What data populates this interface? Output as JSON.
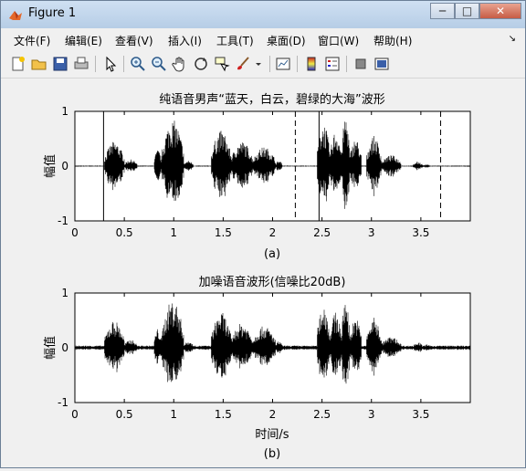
{
  "window": {
    "title": "Figure 1"
  },
  "menus": [
    "文件(F)",
    "编辑(E)",
    "查看(V)",
    "插入(I)",
    "工具(T)",
    "桌面(D)",
    "窗口(W)",
    "帮助(H)"
  ],
  "toolbar_icons": [
    "new-figure-icon",
    "open-icon",
    "save-icon",
    "print-icon",
    "pointer-icon",
    "zoom-in-icon",
    "zoom-out-icon",
    "pan-icon",
    "rotate-3d-icon",
    "data-cursor-icon",
    "brush-icon",
    "brush-menu-icon",
    "link-plot-icon",
    "colorbar-icon",
    "legend-icon",
    "hide-plot-tools-icon",
    "show-plot-tools-icon"
  ],
  "chart_data": [
    {
      "type": "line",
      "title": "纯语音男声“蓝天，白云，碧绿的大海”波形",
      "ylabel": "幅值",
      "xlabel": "",
      "caption": "(a)",
      "xlim": [
        0,
        4
      ],
      "ylim": [
        -1,
        1
      ],
      "xticks": [
        "0",
        "0.5",
        "1",
        "1.5",
        "2",
        "2.5",
        "3",
        "3.5"
      ],
      "yticks": [
        "-1",
        "0",
        "1"
      ],
      "noise_floor": 0.01,
      "segments": [
        {
          "start": 0.3,
          "end": 0.5,
          "amp": 0.45
        },
        {
          "start": 0.5,
          "end": 0.63,
          "amp": 0.12
        },
        {
          "start": 0.8,
          "end": 0.88,
          "amp": 0.3
        },
        {
          "start": 0.88,
          "end": 1.1,
          "amp": 0.85
        },
        {
          "start": 1.1,
          "end": 1.2,
          "amp": 0.1
        },
        {
          "start": 1.38,
          "end": 1.58,
          "amp": 0.65
        },
        {
          "start": 1.58,
          "end": 1.8,
          "amp": 0.45
        },
        {
          "start": 1.8,
          "end": 2.03,
          "amp": 0.35
        },
        {
          "start": 2.03,
          "end": 2.1,
          "amp": 0.1
        },
        {
          "start": 2.45,
          "end": 2.58,
          "amp": 0.8
        },
        {
          "start": 2.58,
          "end": 2.7,
          "amp": 0.65
        },
        {
          "start": 2.7,
          "end": 2.78,
          "amp": 0.95
        },
        {
          "start": 2.78,
          "end": 2.9,
          "amp": 0.5
        },
        {
          "start": 2.95,
          "end": 3.1,
          "amp": 0.55
        },
        {
          "start": 3.1,
          "end": 3.3,
          "amp": 0.2
        },
        {
          "start": 3.42,
          "end": 3.52,
          "amp": 0.08
        },
        {
          "start": 3.52,
          "end": 3.6,
          "amp": 0.03
        }
      ],
      "markers": [
        {
          "x": 0.29,
          "style": "solid"
        },
        {
          "x": 2.23,
          "style": "dashed"
        },
        {
          "x": 2.47,
          "style": "solid"
        },
        {
          "x": 3.7,
          "style": "dashed"
        }
      ]
    },
    {
      "type": "line",
      "title": "加噪语音波形(信噪比20dB)",
      "ylabel": "幅值",
      "xlabel": "时间/s",
      "caption": "(b)",
      "xlim": [
        0,
        4
      ],
      "ylim": [
        -1,
        1
      ],
      "xticks": [
        "0",
        "0.5",
        "1",
        "1.5",
        "2",
        "2.5",
        "3",
        "3.5"
      ],
      "yticks": [
        "-1",
        "0",
        "1"
      ],
      "noise_floor": 0.04,
      "segments": [
        {
          "start": 0.3,
          "end": 0.5,
          "amp": 0.5
        },
        {
          "start": 0.5,
          "end": 0.63,
          "amp": 0.15
        },
        {
          "start": 0.8,
          "end": 0.88,
          "amp": 0.35
        },
        {
          "start": 0.88,
          "end": 1.1,
          "amp": 0.88
        },
        {
          "start": 1.1,
          "end": 1.2,
          "amp": 0.12
        },
        {
          "start": 1.38,
          "end": 1.58,
          "amp": 0.65
        },
        {
          "start": 1.58,
          "end": 1.8,
          "amp": 0.45
        },
        {
          "start": 1.8,
          "end": 2.03,
          "amp": 0.4
        },
        {
          "start": 2.03,
          "end": 2.1,
          "amp": 0.12
        },
        {
          "start": 2.45,
          "end": 2.58,
          "amp": 0.8
        },
        {
          "start": 2.58,
          "end": 2.7,
          "amp": 0.65
        },
        {
          "start": 2.7,
          "end": 2.78,
          "amp": 0.95
        },
        {
          "start": 2.78,
          "end": 2.9,
          "amp": 0.55
        },
        {
          "start": 2.95,
          "end": 3.1,
          "amp": 0.55
        },
        {
          "start": 3.1,
          "end": 3.3,
          "amp": 0.2
        },
        {
          "start": 3.42,
          "end": 3.52,
          "amp": 0.1
        },
        {
          "start": 3.52,
          "end": 3.6,
          "amp": 0.06
        }
      ],
      "markers": []
    }
  ]
}
